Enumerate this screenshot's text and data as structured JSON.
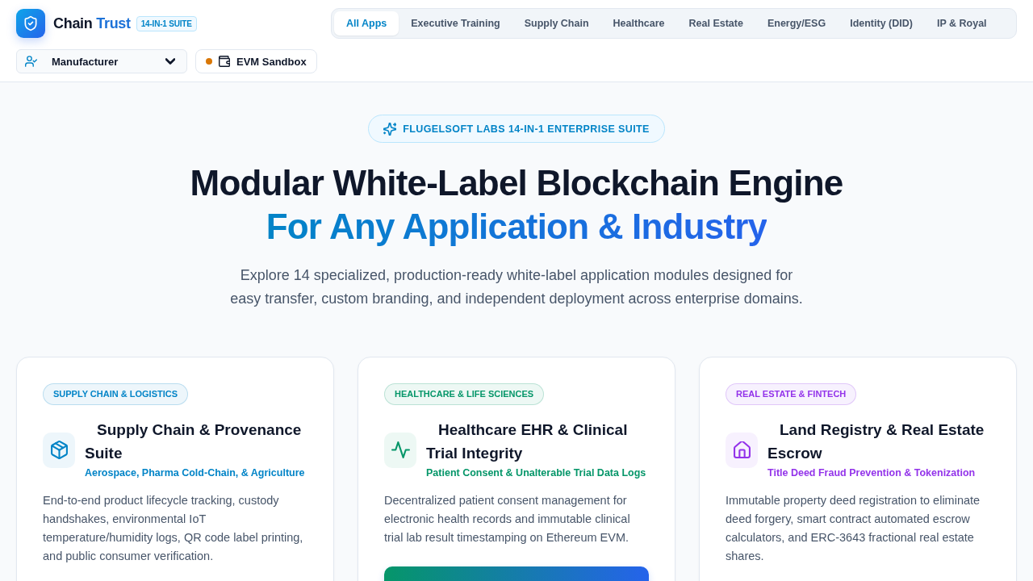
{
  "header": {
    "brand": {
      "name": "Chain",
      "name_accent": "Trust",
      "badge": "14-IN-1 SUITE"
    },
    "tabs": [
      {
        "label": "All Apps",
        "selected": true
      },
      {
        "label": "Executive Training",
        "selected": false
      },
      {
        "label": "Supply Chain",
        "selected": false
      },
      {
        "label": "Healthcare",
        "selected": false
      },
      {
        "label": "Real Estate",
        "selected": false
      },
      {
        "label": "Energy/ESG",
        "selected": false
      },
      {
        "label": "Identity (DID)",
        "selected": false
      },
      {
        "label": "IP & Royal",
        "selected": false
      }
    ],
    "role_select": {
      "value": "Manufacturer"
    },
    "network": {
      "label": "EVM Sandbox",
      "color": "#d97706"
    }
  },
  "hero": {
    "badge": "FLUGELSOFT LABS 14-IN-1 ENTERPRISE SUITE",
    "title": "Modular White-Label Blockchain Engine",
    "title_accent": "For Any Application & Industry",
    "description": "Explore 14 specialized, production-ready white-label application modules designed for easy transfer, custom branding, and independent deployment across enterprise domains."
  },
  "cards": [
    {
      "tag": "SUPPLY CHAIN & LOGISTICS",
      "title": "Supply Chain & Provenance Suite",
      "subtitle": "Aerospace, Pharma Cold-Chain, & Agriculture",
      "description": "End-to-end product lifecycle tracking, custody handshakes, environmental IoT temperature/humidity logs, QR code label printing, and public consumer verification.",
      "color": "#0284c7"
    },
    {
      "tag": "HEALTHCARE & LIFE SCIENCES",
      "title": "Healthcare EHR & Clinical Trial Integrity",
      "subtitle": "Patient Consent & Unalterable Trial Data Logs",
      "description": "Decentralized patient consent management for electronic health records and immutable clinical trial lab result timestamping on Ethereum EVM.",
      "color": "#059669",
      "action_button": true
    },
    {
      "tag": "REAL ESTATE & FINTECH",
      "title": "Land Registry & Real Estate Escrow",
      "subtitle": "Title Deed Fraud Prevention & Tokenization",
      "description": "Immutable property deed registration to eliminate deed forgery, smart contract automated escrow calculators, and ERC-3643 fractional real estate shares.",
      "color": "#9333ea"
    }
  ]
}
